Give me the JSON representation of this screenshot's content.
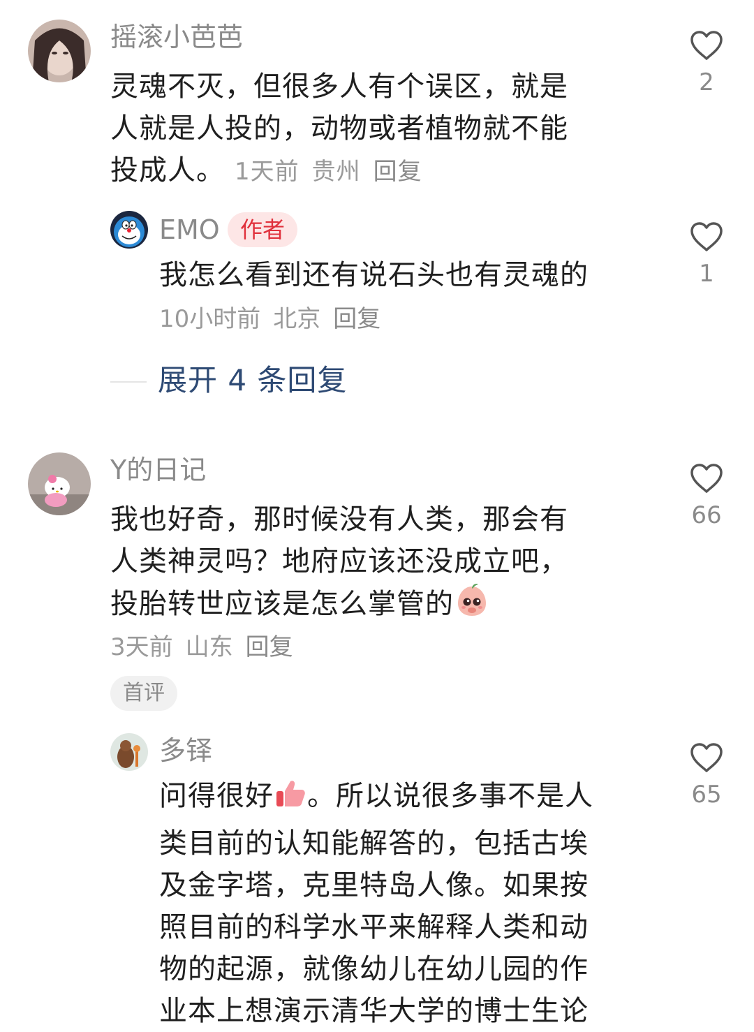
{
  "comments": [
    {
      "username": "摇滚小芭芭",
      "lines": [
        "灵魂不灭，但很多人有个误区，就是",
        "人就是人投的，动物或者植物就不能",
        "投成人。"
      ],
      "time": "1天前",
      "location": "贵州",
      "reply_label": "回复",
      "likes": "2",
      "replies": [
        {
          "username": "EMO",
          "badge": "作者",
          "lines": [
            "我怎么看到还有说石头也有灵魂的"
          ],
          "time": "10小时前",
          "location": "北京",
          "reply_label": "回复",
          "likes": "1"
        }
      ],
      "expand_label": "展开 4 条回复"
    },
    {
      "username": "Y的日记",
      "lines": [
        "我也好奇，那时候没有人类，那会有",
        "人类神灵吗？地府应该还没成立吧，",
        "投胎转世应该是怎么掌管的"
      ],
      "time": "3天前",
      "location": "山东",
      "reply_label": "回复",
      "likes": "66",
      "tag": "首评",
      "replies": [
        {
          "username": "多铎",
          "lines": [
            "问得很好",
            "。所以说很多事不是人",
            "类目前的认知能解答的，包括古埃",
            "及金字塔，克里特岛人像。如果按",
            "照目前的科学水平来解释人类和动",
            "物的起源，就像幼儿在幼儿园的作",
            "业本上想演示清华大学的博士生论"
          ],
          "likes": "65"
        }
      ]
    }
  ],
  "icons": {
    "like": "heart-outline-icon",
    "emoji_cry": "peach-crying-emoji",
    "emoji_thumb": "thumbs-up-emoji"
  },
  "colors": {
    "author_badge_bg": "#fde6e6",
    "author_badge_text": "#e0313c",
    "expand_link": "#2e4a74"
  }
}
